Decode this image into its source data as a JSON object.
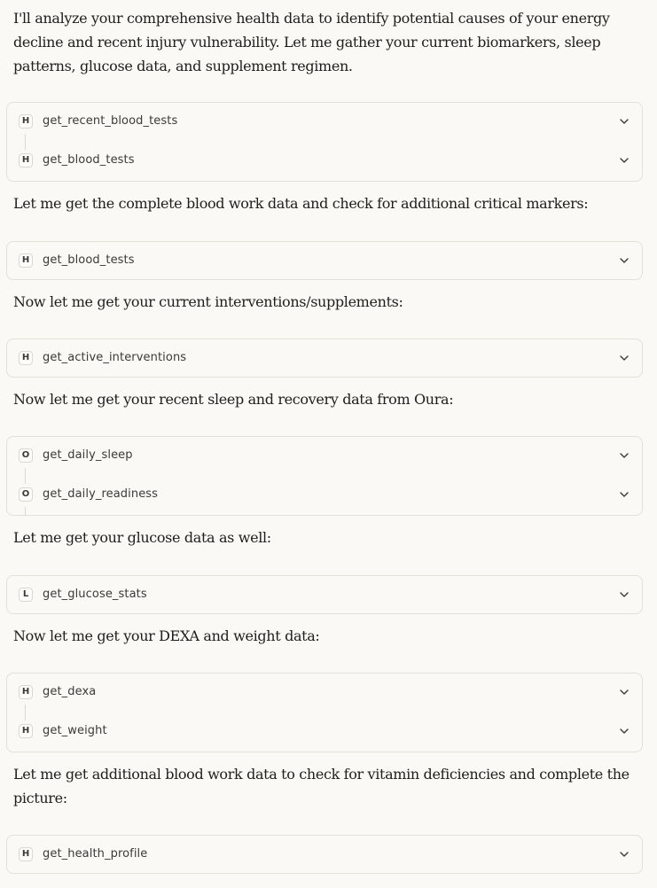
{
  "intro": "I'll analyze your comprehensive health data to identify potential causes of your energy decline and recent injury vulnerability. Let me gather your current biomarkers, sleep patterns, glucose data, and supplement regimen.",
  "groups": [
    {
      "calls": [
        {
          "badge": "H",
          "name": "get_recent_blood_tests"
        },
        {
          "badge": "H",
          "name": "get_blood_tests"
        }
      ]
    },
    {
      "calls": [
        {
          "badge": "H",
          "name": "get_blood_tests"
        }
      ]
    },
    {
      "calls": [
        {
          "badge": "H",
          "name": "get_active_interventions"
        }
      ]
    },
    {
      "calls": [
        {
          "badge": "O",
          "name": "get_daily_sleep"
        },
        {
          "badge": "O",
          "name": "get_daily_readiness"
        }
      ]
    },
    {
      "calls": [
        {
          "badge": "L",
          "name": "get_glucose_stats"
        }
      ]
    },
    {
      "calls": [
        {
          "badge": "H",
          "name": "get_dexa"
        },
        {
          "badge": "H",
          "name": "get_weight"
        }
      ]
    },
    {
      "calls": [
        {
          "badge": "H",
          "name": "get_health_profile"
        }
      ]
    }
  ],
  "messages": [
    "Let me get the complete blood work data and check for additional critical markers:",
    "Now let me get your current interventions/supplements:",
    "Now let me get your recent sleep and recovery data from Oura:",
    "Let me get your glucose data as well:",
    "Now let me get your DEXA and weight data:",
    "Let me get additional blood work data to check for vitamin deficiencies and complete the picture:"
  ],
  "icons": {
    "expand": "chevron-down-icon",
    "connector": "vertical-connector-line"
  }
}
